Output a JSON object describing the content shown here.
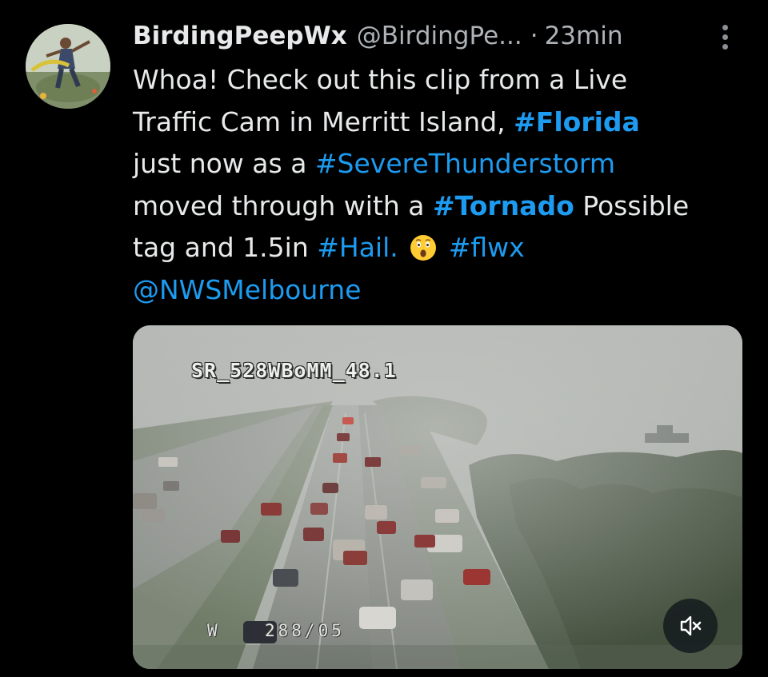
{
  "tweet": {
    "display_name": "BirdingPeepWx",
    "handle": "@BirdingPe...",
    "separator": "·",
    "time": "23min",
    "text": {
      "line1": "Whoa! Check out this clip from a Live",
      "line2_pre": "Traffic Cam in Merritt Island, ",
      "line2_tag": "#Florida",
      "line3_pre": "just now as a ",
      "line3_tag": "#SevereThunderstorm",
      "line4_pre": "moved through with a ",
      "line4_tag": "#Tornado",
      "line4_post": " Possible",
      "line5_pre": "tag and 1.5in ",
      "line5_tag": "#Hail.",
      "line5_tag2": "#flwx",
      "line6_mention": "@NWSMelbourne"
    },
    "avatar_icon": "profile-avatar",
    "more_icon": "more-vertical-icon"
  },
  "video": {
    "camera_label": "SR_528WBoMM_48.1",
    "direction_label": "W",
    "compass_label": "288/05",
    "mute_icon": "muted-speaker-icon"
  },
  "colors": {
    "background": "#000000",
    "text": "#e7e9ea",
    "secondary": "#aeb3b8",
    "link": "#1d9bf0"
  }
}
